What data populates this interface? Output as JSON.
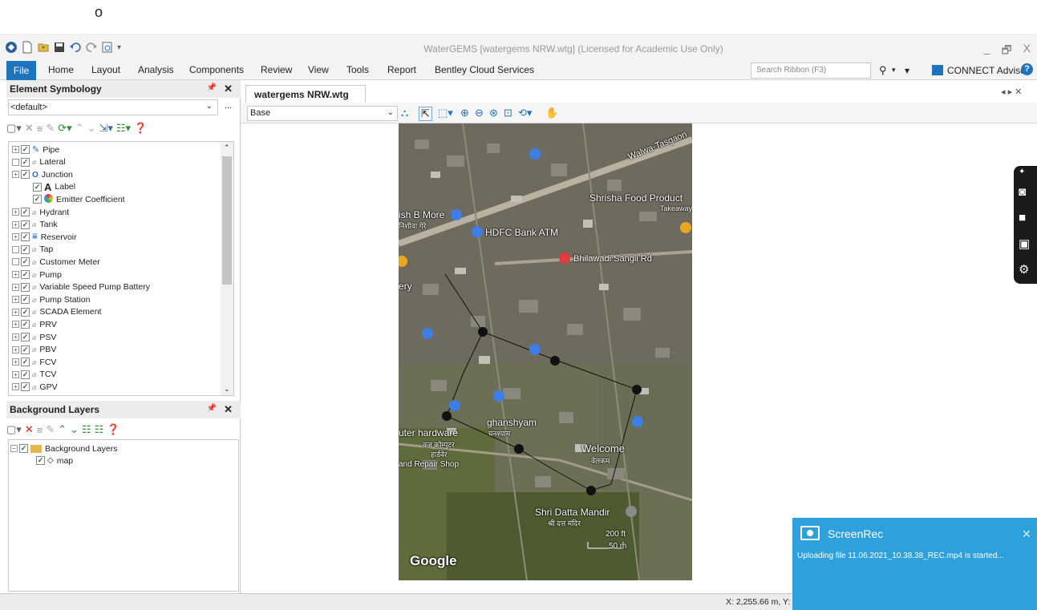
{
  "stray_char": "o",
  "window": {
    "title": "WaterGEMS [watergems NRW.wtg] (Licensed for Academic Use Only)",
    "minimize": "_",
    "restore": "🗗",
    "close": "X"
  },
  "ribbon": {
    "file": "File",
    "tabs": [
      "Home",
      "Layout",
      "Analysis",
      "Components",
      "Review",
      "View",
      "Tools",
      "Report",
      "Bentley Cloud Services"
    ],
    "search_placeholder": "Search Ribbon (F3)",
    "connect_advisor": "CONNECT Advisor"
  },
  "element_symbology": {
    "title": "Element Symbology",
    "dropdown_value": "<default>",
    "more": "...",
    "items": [
      {
        "label": "Pipe",
        "expand": true,
        "icon": "pipe-icon",
        "indent": 0
      },
      {
        "label": "Lateral",
        "expand": false,
        "icon": "label-icon",
        "indent": 0
      },
      {
        "label": "Junction",
        "expand": true,
        "icon": "junction-icon",
        "indent": 0
      },
      {
        "label": "Label",
        "expand": false,
        "icon": "text-label-icon",
        "indent": 1
      },
      {
        "label": "Emitter Coefficient",
        "expand": false,
        "icon": "color-coding-icon",
        "indent": 1
      },
      {
        "label": "Hydrant",
        "expand": true,
        "icon": "label-icon",
        "indent": 0
      },
      {
        "label": "Tank",
        "expand": true,
        "icon": "label-icon",
        "indent": 0
      },
      {
        "label": "Reservoir",
        "expand": true,
        "icon": "reservoir-icon",
        "indent": 0
      },
      {
        "label": "Tap",
        "expand": false,
        "icon": "label-icon",
        "indent": 0
      },
      {
        "label": "Customer Meter",
        "expand": false,
        "icon": "label-icon",
        "indent": 0
      },
      {
        "label": "Pump",
        "expand": true,
        "icon": "label-icon",
        "indent": 0
      },
      {
        "label": "Variable Speed Pump Battery",
        "expand": true,
        "icon": "label-icon",
        "indent": 0
      },
      {
        "label": "Pump Station",
        "expand": true,
        "icon": "label-icon",
        "indent": 0
      },
      {
        "label": "SCADA Element",
        "expand": true,
        "icon": "label-icon",
        "indent": 0
      },
      {
        "label": "PRV",
        "expand": true,
        "icon": "label-icon",
        "indent": 0
      },
      {
        "label": "PSV",
        "expand": true,
        "icon": "label-icon",
        "indent": 0
      },
      {
        "label": "PBV",
        "expand": true,
        "icon": "label-icon",
        "indent": 0
      },
      {
        "label": "FCV",
        "expand": true,
        "icon": "label-icon",
        "indent": 0
      },
      {
        "label": "TCV",
        "expand": true,
        "icon": "label-icon",
        "indent": 0
      },
      {
        "label": "GPV",
        "expand": true,
        "icon": "label-icon",
        "indent": 0
      }
    ]
  },
  "background_layers": {
    "title": "Background Layers",
    "root": "Background Layers",
    "child": "map"
  },
  "document": {
    "tab": "watergems NRW.wtg",
    "scenario": "Base"
  },
  "map": {
    "labels": [
      "Walwa-Tasgaon",
      "Shrisha Food Product",
      "Takeaway",
      "ish B More",
      "निशीवा गेरे",
      "HDFC Bank ATM",
      "Bhilawadi Sangli Rd",
      "ery",
      "ghanshyam",
      "घनश्याम",
      "uter hardware",
      "वज कोम्पुटर",
      "हार्डवेर",
      "and Repair Shop",
      "Welcome",
      "वेलकम",
      "Shri Datta Mandir",
      "श्री दत्त मंदिर",
      "200 ft",
      "50 m",
      "Google"
    ]
  },
  "status": {
    "coords": "X: 2,255.66 m, Y:"
  },
  "toast": {
    "title": "ScreenRec",
    "message": "Uploading file 11.06.2021_10.38.38_REC.mp4 is started..."
  }
}
